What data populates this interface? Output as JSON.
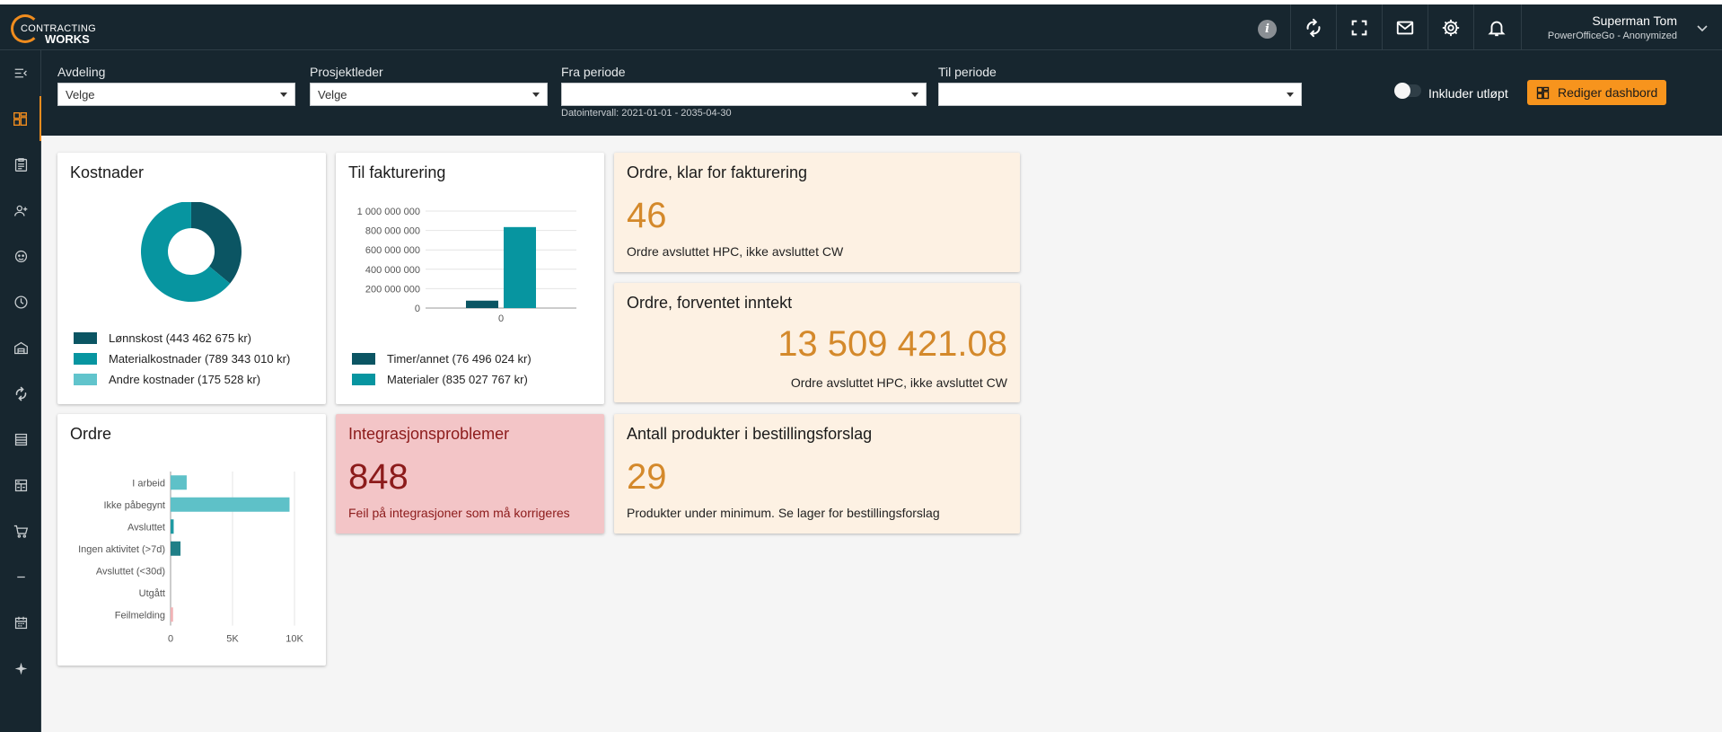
{
  "brand": {
    "logo_top": "CONTRACTING",
    "logo_bottom": "WORKS",
    "accent": "#f08c1e"
  },
  "topbar": {
    "info_icon": "info-icon",
    "icons": [
      "sync-icon",
      "fullscreen-icon",
      "mail-icon",
      "gear-icon",
      "bell-icon"
    ],
    "user_name": "Superman Tom",
    "user_company": "PowerOfficeGo - Anonymized"
  },
  "sidebar": {
    "items": [
      "collapse-menu-icon",
      "dashboard-icon",
      "orders-icon",
      "customers-icon",
      "support-icon",
      "clock-icon",
      "warehouse-icon",
      "sync-icon",
      "list-icon",
      "calculator-icon",
      "cart-icon",
      "minus-icon",
      "calendar-icon",
      "sparkle-icon"
    ]
  },
  "filters": {
    "avdeling_label": "Avdeling",
    "avdeling_value": "Velge",
    "prosjektleder_label": "Prosjektleder",
    "prosjektleder_value": "Velge",
    "fra_label": "Fra periode",
    "fra_value": "",
    "til_label": "Til periode",
    "til_value": "",
    "date_interval": "Datointervall: 2021-01-01 - 2035-04-30",
    "include_expired": "Inkluder utløpt",
    "edit_dashboard": "Rediger dashbord"
  },
  "cards": {
    "kostnader": {
      "title": "Kostnader",
      "legend": [
        {
          "label": "Lønnskost (443 462 675 kr)",
          "color": "#0b5563"
        },
        {
          "label": "Materialkostnader (789 343 010 kr)",
          "color": "#0795a0"
        },
        {
          "label": "Andre kostnader (175 528 kr)",
          "color": "#61c4cc"
        }
      ]
    },
    "fakturering": {
      "title": "Til fakturering",
      "legend": [
        {
          "label": "Timer/annet (76 496 024 kr)",
          "color": "#0b5563"
        },
        {
          "label": "Materialer (835 027 767 kr)",
          "color": "#0795a0"
        }
      ]
    },
    "ordre_klar": {
      "title": "Ordre, klar for fakturering",
      "value": "46",
      "subtitle": "Ordre avsluttet HPC, ikke avsluttet CW"
    },
    "ordre_inntekt": {
      "title": "Ordre, forventet inntekt",
      "value": "13 509 421.08",
      "subtitle": "Ordre avsluttet HPC, ikke avsluttet CW"
    },
    "ordre": {
      "title": "Ordre"
    },
    "integrasjon": {
      "title": "Integrasjonsproblemer",
      "value": "848",
      "subtitle": "Feil på integrasjoner som må korrigeres"
    },
    "produkter": {
      "title": "Antall produkter i bestillingsforslag",
      "value": "29",
      "subtitle": "Produkter under minimum. Se lager for bestillingsforslag"
    }
  },
  "chart_data": [
    {
      "type": "pie",
      "title": "Kostnader",
      "categories": [
        "Lønnskost",
        "Materialkostnader",
        "Andre kostnader"
      ],
      "values": [
        443462675,
        789343010,
        175528
      ],
      "colors": [
        "#0b5563",
        "#0795a0",
        "#61c4cc"
      ]
    },
    {
      "type": "bar",
      "title": "Til fakturering",
      "categories": [
        "0"
      ],
      "series": [
        {
          "name": "Timer/annet",
          "values": [
            76496024
          ],
          "color": "#0b5563"
        },
        {
          "name": "Materialer",
          "values": [
            835027767
          ],
          "color": "#0795a0"
        }
      ],
      "ylim": [
        0,
        1000000000
      ],
      "yticks": [
        "0",
        "200 000 000",
        "400 000 000",
        "600 000 000",
        "800 000 000",
        "1 000 000 000"
      ],
      "grid": true
    },
    {
      "type": "bar",
      "orientation": "horizontal",
      "title": "Ordre",
      "categories": [
        "I arbeid",
        "Ikke påbegynt",
        "Avsluttet",
        "Ingen aktivitet (>7d)",
        "Avsluttet (<30d)",
        "Utgått",
        "Feilmelding"
      ],
      "values": [
        1300,
        9600,
        250,
        800,
        0,
        0,
        200
      ],
      "colors": [
        "#5ec1c8",
        "#5ec1c8",
        "#1f9aa3",
        "#1f7f87",
        "#1f7f87",
        "#1f7f87",
        "#f1b3b6"
      ],
      "xlim": [
        0,
        10000
      ],
      "xticks": [
        "0",
        "5K",
        "10K"
      ],
      "grid": true
    }
  ]
}
